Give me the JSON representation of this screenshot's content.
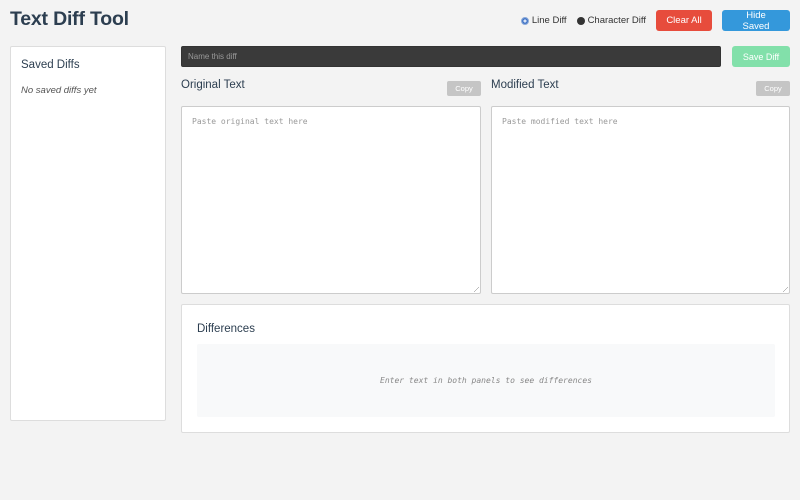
{
  "app": {
    "title": "Text Diff Tool"
  },
  "mode": {
    "options": [
      {
        "label": "Line Diff",
        "checked": true
      },
      {
        "label": "Character Diff",
        "checked": false
      }
    ]
  },
  "toolbar": {
    "clear_label": "Clear All",
    "hide_saved_label": "Hide Saved",
    "clear_color": "#e74c3c",
    "hide_color": "#3498db"
  },
  "sidebar": {
    "title": "Saved Diffs",
    "empty_text": "No saved diffs yet"
  },
  "save": {
    "name_placeholder": "Name this diff",
    "name_value": "",
    "save_label": "Save Diff",
    "save_color": "#82e0aa"
  },
  "original": {
    "title": "Original Text",
    "copy_label": "Copy",
    "placeholder": "Paste original text here",
    "value": ""
  },
  "modified": {
    "title": "Modified Text",
    "copy_label": "Copy",
    "placeholder": "Paste modified text here",
    "value": ""
  },
  "differences": {
    "title": "Differences",
    "empty_text": "Enter text in both panels to see differences"
  }
}
